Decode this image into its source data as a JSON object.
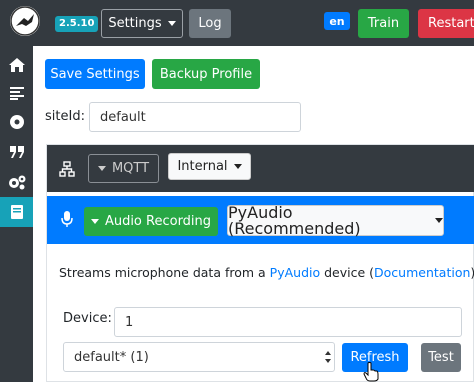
{
  "topbar": {
    "version": "2.5.10",
    "settings_label": "Settings",
    "log_label": "Log",
    "language": "en",
    "train_label": "Train",
    "restart_label": "Restart"
  },
  "sidebar": {
    "items": [
      {
        "icon": "home-icon"
      },
      {
        "icon": "list-icon"
      },
      {
        "icon": "record-icon"
      },
      {
        "icon": "quote-icon"
      },
      {
        "icon": "gears-icon"
      },
      {
        "icon": "book-icon",
        "active": true
      }
    ]
  },
  "actions": {
    "save_label": "Save Settings",
    "backup_label": "Backup Profile"
  },
  "site_id": {
    "label": "siteId:",
    "value": "default"
  },
  "mqtt": {
    "button_label": "MQTT",
    "mode": "Internal"
  },
  "audio": {
    "button_label": "Audio Recording",
    "system": "PyAudio (Recommended)",
    "description_prefix": "Streams microphone data from a ",
    "pyaudio_link": "PyAudio",
    "description_middle": " device (",
    "documentation_link": "Documentation",
    "description_suffix": ")",
    "device_label": "Device:",
    "device_value": "1",
    "device_selected": "default* (1)",
    "refresh_label": "Refresh",
    "test_label": "Test"
  },
  "colors": {
    "dark": "#343a40",
    "primary": "#007bff",
    "success": "#28a745",
    "danger": "#dc3545",
    "info": "#17a2b8",
    "secondary": "#6c757d"
  }
}
